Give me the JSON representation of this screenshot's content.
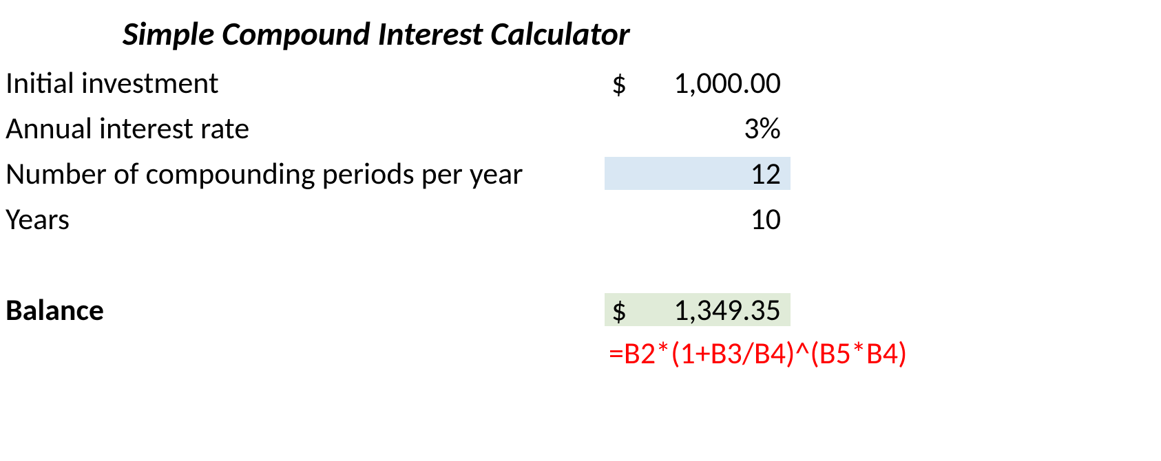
{
  "title": "Simple Compound Interest Calculator",
  "labels": {
    "initial": "Initial investment",
    "rate": "Annual interest rate",
    "periods": "Number of compounding periods per year",
    "years": "Years",
    "balance": "Balance"
  },
  "values": {
    "initial_sym": "$",
    "initial_num": "1,000.00",
    "rate": "3%",
    "periods": "12",
    "years": "10",
    "balance_sym": "$",
    "balance_num": "1,349.35"
  },
  "formula": "=B2*(1+B3/B4)^(B5*B4)"
}
